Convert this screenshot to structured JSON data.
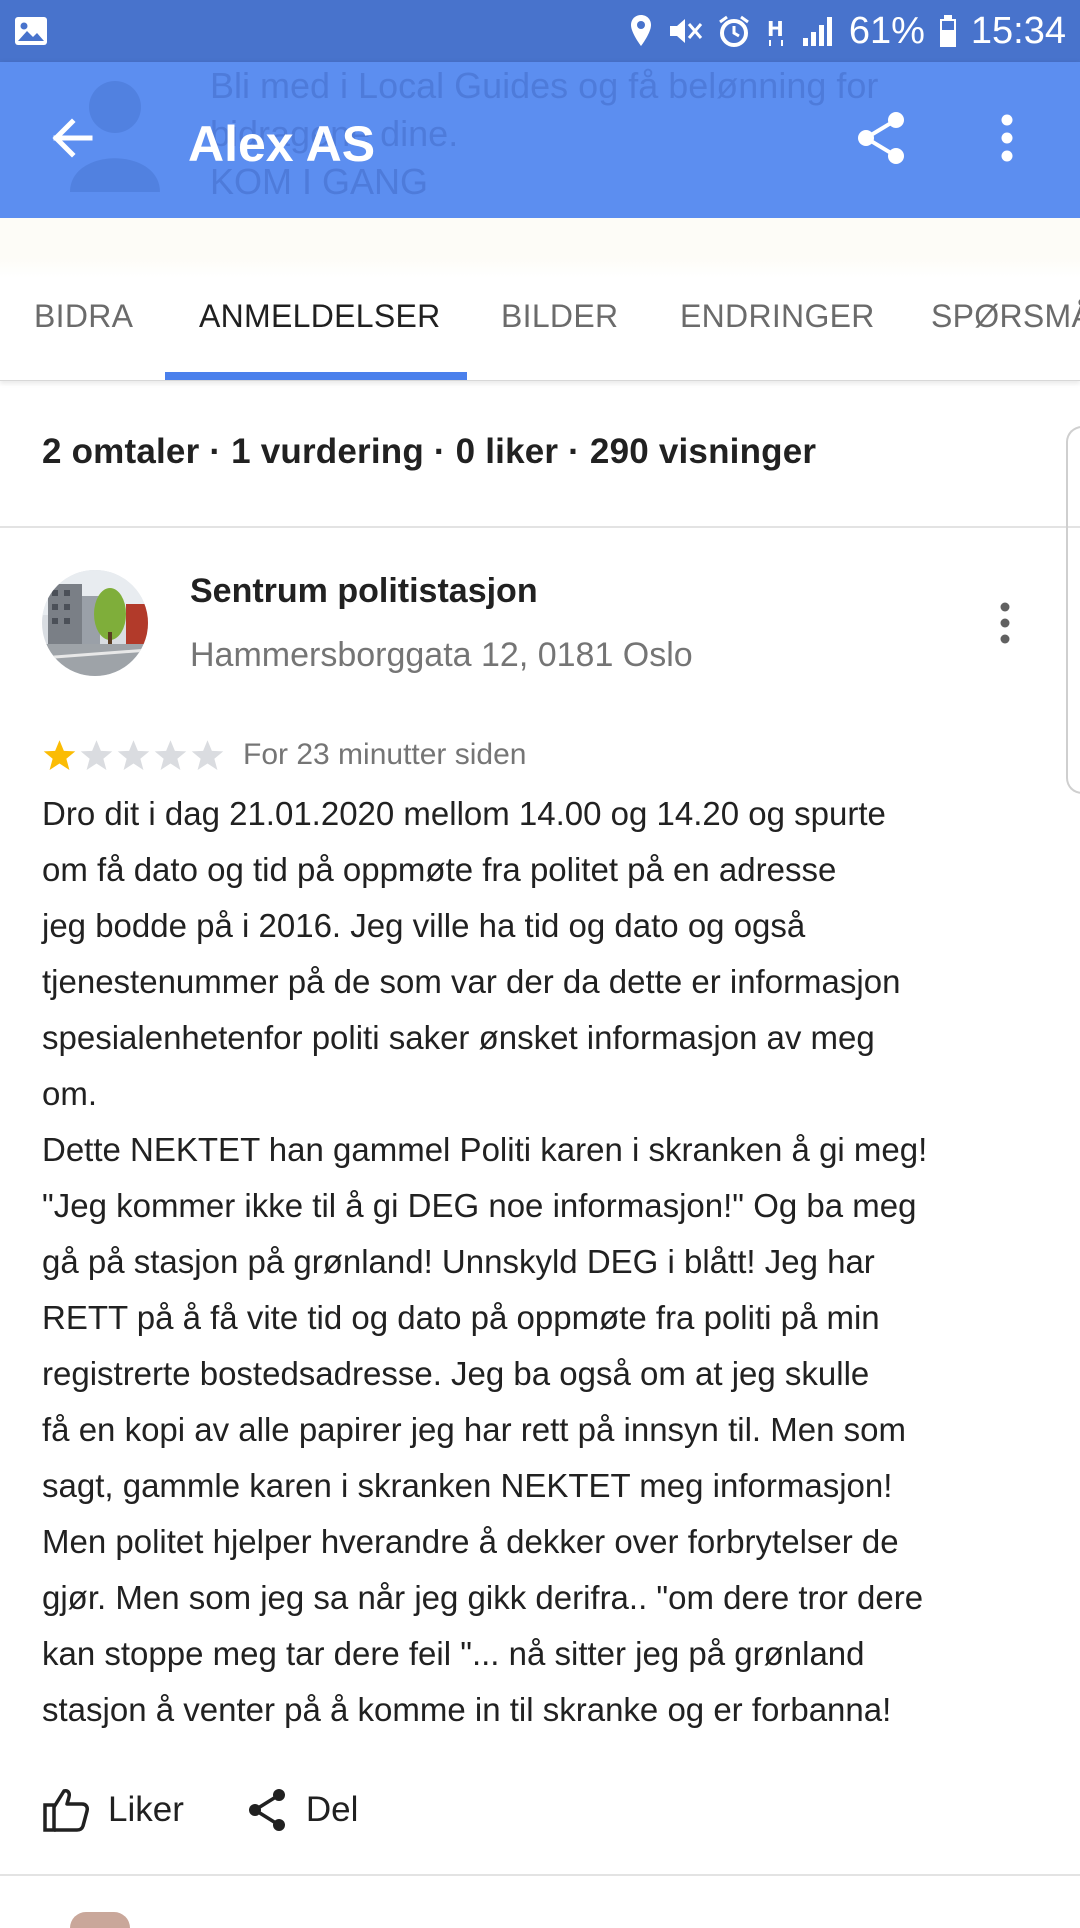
{
  "status_bar": {
    "battery": "61%",
    "time": "15:34"
  },
  "app_bar": {
    "title": "Alex AS",
    "ghost_lines": [
      "Bli med i Local Guides og få belønning for",
      "bidragene dine.",
      "KOM I GANG"
    ]
  },
  "tabs": [
    {
      "label": "BIDRA",
      "active": false
    },
    {
      "label": "ANMELDELSER",
      "active": true
    },
    {
      "label": "BILDER",
      "active": false
    },
    {
      "label": "ENDRINGER",
      "active": false
    },
    {
      "label": "SPØRSMÅ",
      "active": false
    }
  ],
  "stats": "2 omtaler · 1 vurdering · 0 liker · 290 visninger",
  "review": {
    "place_name": "Sentrum politistasjon",
    "address": "Hammersborggata 12, 0181 Oslo",
    "rating": 1,
    "max_rating": 5,
    "time": "For 23 minutter siden",
    "text": "Dro dit i dag 21.01.2020 mellom 14.00 og 14.20 og spurte\nom få dato og tid på oppmøte fra politet på en adresse\njeg bodde på i 2016. Jeg ville ha tid og dato og også\ntjenestenummer på de som var der da dette er informasjon\nspesialenhetenfor politi saker ønsket informasjon av meg\nom.\nDette NEKTET han gammel Politi karen i skranken å gi meg!\n\"Jeg kommer ikke til å gi DEG noe informasjon!\" Og ba meg\ngå på stasjon på grønland! Unnskyld DEG i blått! Jeg har\nRETT på å få vite tid og dato på oppmøte fra politi på min\nregistrerte  bostedsadresse. Jeg ba også om at jeg skulle\nfå en kopi av alle papirer jeg har rett på innsyn til. Men som\nsagt, gammle karen i skranken NEKTET meg informasjon!\nMen politet hjelper hverandre å dekker over forbrytelser de\ngjør. Men som jeg sa når jeg gikk derifra.. \"om dere tror dere\nkan stoppe meg tar dere feil \"... nå sitter jeg på grønland\nstasjon å venter på å komme in til skranke og er forbanna!",
    "like_label": "Liker",
    "share_label": "Del"
  },
  "colors": {
    "status_bar": "#4873cc",
    "app_bar": "#5c8ef0",
    "tab_indicator": "#4a80ec",
    "star_filled": "#fbbc04",
    "star_empty": "#dadce0"
  }
}
